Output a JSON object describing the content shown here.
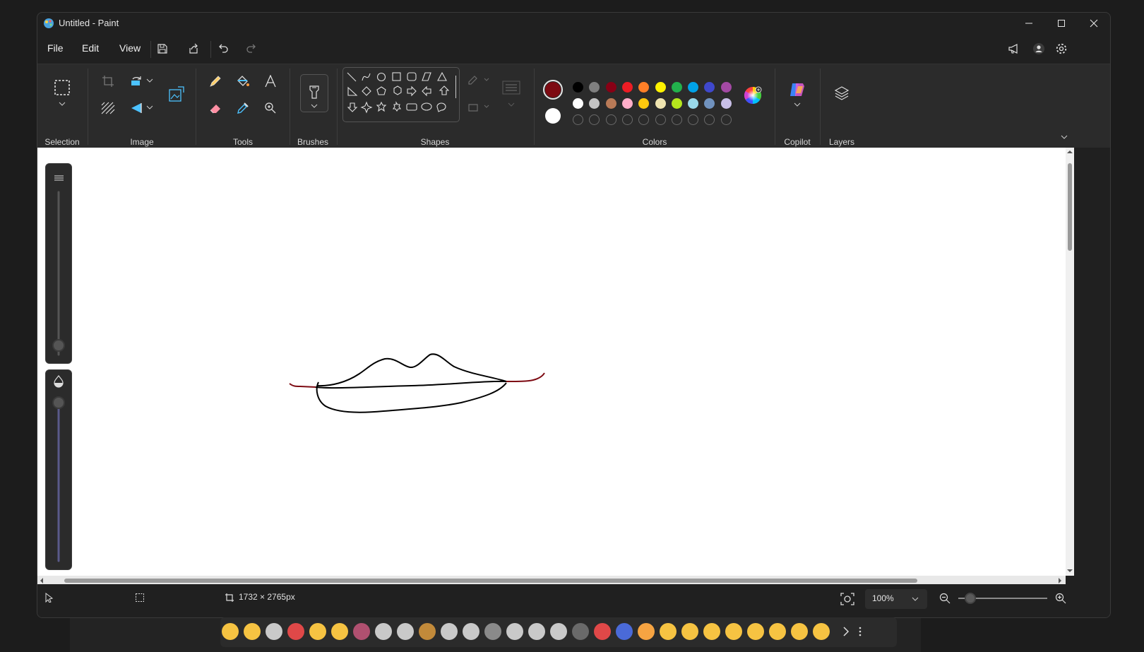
{
  "window": {
    "title": "Untitled - Paint"
  },
  "menu": {
    "file": "File",
    "edit": "Edit",
    "view": "View"
  },
  "ribbon": {
    "selection": "Selection",
    "image": "Image",
    "tools": "Tools",
    "brushes": "Brushes",
    "shapes": "Shapes",
    "colors": "Colors",
    "copilot": "Copilot",
    "layers": "Layers"
  },
  "colors": {
    "primary": "#7d0a12",
    "secondary": "#ffffff",
    "palette_row1": [
      "#000000",
      "#7f7f7f",
      "#880015",
      "#ed1c24",
      "#ff7f27",
      "#fff200",
      "#22b14c",
      "#00a2e8",
      "#3f48cc",
      "#a349a4"
    ],
    "palette_row2": [
      "#ffffff",
      "#c3c3c3",
      "#b97a57",
      "#ffaec9",
      "#ffc90e",
      "#efe4b0",
      "#b5e61d",
      "#99d9ea",
      "#7092be",
      "#c8bfe7"
    ]
  },
  "status": {
    "canvas_size": "1732 × 2765px",
    "zoom": "100%"
  },
  "canvas": {
    "drawing": "lips-sketch",
    "stroke_colors": [
      "#000000",
      "#7d0a12"
    ]
  },
  "emoji_bar": {
    "items": [
      "laughing-crying",
      "winking",
      "zombie",
      "red-x",
      "screaming",
      "heart-eyes",
      "bird",
      "skier",
      "ghost",
      "monkey",
      "zombie",
      "alien",
      "text",
      "ghost",
      "snowboarder",
      "ghost",
      "pen",
      "pill",
      "pill-blue",
      "smile-teeth",
      "slight-smile",
      "tongue",
      "grin",
      "laughing",
      "rofl",
      "joy",
      "star-struck",
      "wink"
    ]
  }
}
